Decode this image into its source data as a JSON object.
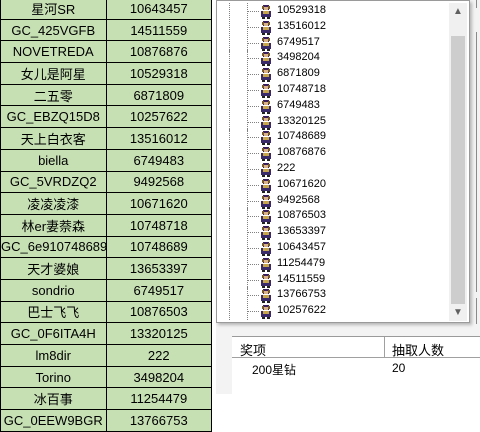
{
  "sheet": {
    "rows": [
      {
        "name": "星河SR",
        "id": "10643457",
        "mark": "right"
      },
      {
        "name": "GC_425VGFB",
        "id": "14511559",
        "mark": "right"
      },
      {
        "name": "NOVETREDA",
        "id": "10876876",
        "mark": "right"
      },
      {
        "name": "女儿是阿星",
        "id": "10529318",
        "mark": "right"
      },
      {
        "name": "二五零",
        "id": "6871809",
        "mark": "right"
      },
      {
        "name": "GC_EBZQ15D8",
        "id": "10257622",
        "mark": "right"
      },
      {
        "name": "天上白衣客",
        "id": "13516012",
        "mark": "right"
      },
      {
        "name": "biella",
        "id": "6749483",
        "mark": "right"
      },
      {
        "name": "GC_5VRDZQ2",
        "id": "9492568",
        "mark": "right"
      },
      {
        "name": "凌凌凌漆",
        "id": "10671620",
        "mark": "right"
      },
      {
        "name": "林er妻萘森",
        "id": "10748718",
        "mark": "right"
      },
      {
        "name": "GC_6e910748689",
        "id": "10748689",
        "mark": "left"
      },
      {
        "name": "天才婆娘",
        "id": "13653397",
        "mark": "right"
      },
      {
        "name": "sondrio",
        "id": "6749517",
        "mark": "right"
      },
      {
        "name": "巴士飞飞",
        "id": "10876503",
        "mark": "right"
      },
      {
        "name": "GC_0F6ITA4H",
        "id": "13320125",
        "mark": "right"
      },
      {
        "name": "lm8dir",
        "id": "222",
        "mark": "right"
      },
      {
        "name": "Torino",
        "id": "3498204",
        "mark": "right"
      },
      {
        "name": "冰百事",
        "id": "11254479",
        "mark": "right"
      },
      {
        "name": "GC_0EEW9BGR",
        "id": "13766753",
        "mark": "right"
      }
    ],
    "fill_color": "#c6e0b4",
    "mark_color": "#0a7a2c"
  },
  "tree": {
    "items": [
      "10529318",
      "13516012",
      "6749517",
      "3498204",
      "6871809",
      "10748718",
      "6749483",
      "13320125",
      "10748689",
      "10876876",
      "222",
      "10671620",
      "9492568",
      "10876503",
      "13653397",
      "10643457",
      "11254479",
      "14511559",
      "13766753",
      "10257622"
    ],
    "icon": "user-avatar-icon"
  },
  "scrollbar": {
    "up_arrow": "▲",
    "down_arrow": "▼"
  },
  "prize_table": {
    "headers": [
      "奖项",
      "抽取人数"
    ],
    "rows": [
      {
        "prize": "200星钻",
        "count": "20"
      }
    ]
  }
}
